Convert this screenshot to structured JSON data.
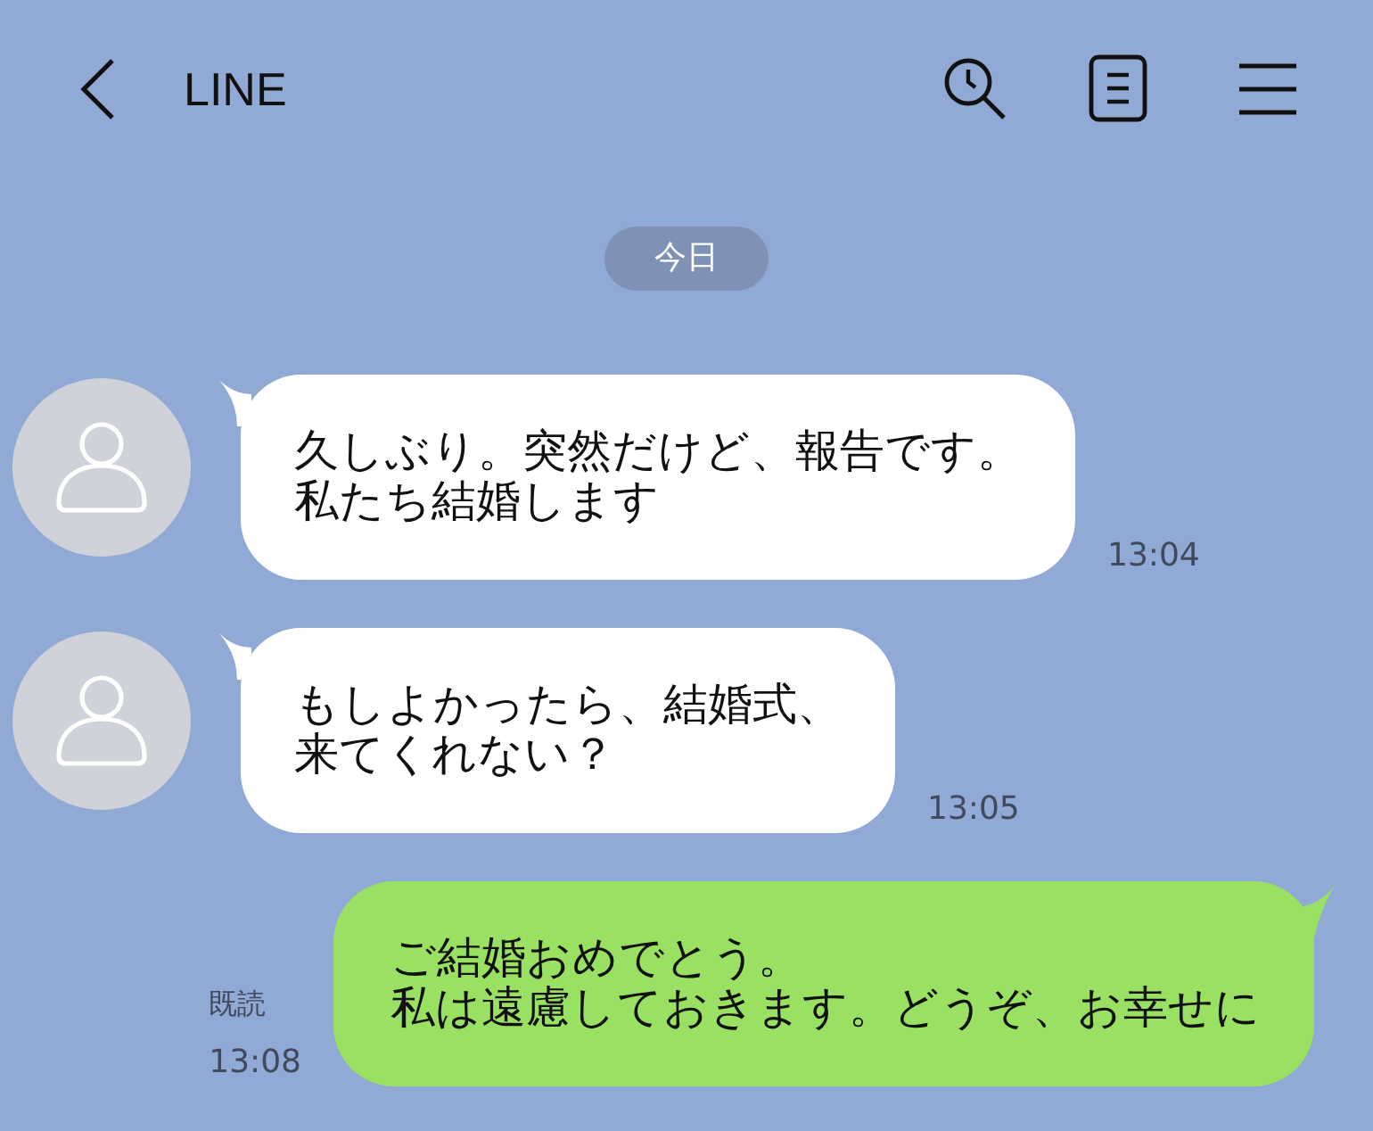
{
  "header": {
    "title": "LINE"
  },
  "date_label": "今日",
  "messages": [
    {
      "kind": "incoming",
      "lines": [
        "久しぶり。突然だけど、報告です。",
        "私たち結婚します"
      ],
      "time": "13:04"
    },
    {
      "kind": "incoming",
      "lines": [
        "もしよかったら、結婚式、",
        "来てくれない？"
      ],
      "time": "13:05"
    },
    {
      "kind": "outgoing",
      "lines": [
        "ご結婚おめでとう。",
        "私は遠慮しておきます。どうぞ、お幸せに"
      ],
      "read": "既読",
      "time": "13:08"
    }
  ]
}
